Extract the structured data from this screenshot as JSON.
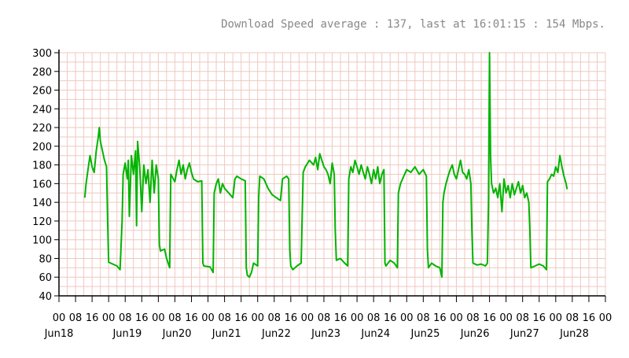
{
  "chart_data": {
    "type": "line",
    "title": "Download Speed average : 137, last at 16:01:15 : 154 Mbps.",
    "xlabel": "",
    "ylabel": "",
    "ylim": [
      40,
      300
    ],
    "yticks": [
      40,
      60,
      80,
      100,
      120,
      140,
      160,
      180,
      200,
      220,
      240,
      260,
      280,
      300
    ],
    "xlim": [
      0,
      264
    ],
    "x_unit": "hours since Jun18 00:00",
    "x_ticks": [
      {
        "hour": 0,
        "label": "00"
      },
      {
        "hour": 8,
        "label": "08"
      },
      {
        "hour": 16,
        "label": "16"
      },
      {
        "hour": 24,
        "label": "00"
      },
      {
        "hour": 32,
        "label": "08"
      },
      {
        "hour": 40,
        "label": "16"
      },
      {
        "hour": 48,
        "label": "00"
      },
      {
        "hour": 56,
        "label": "08"
      },
      {
        "hour": 64,
        "label": "16"
      },
      {
        "hour": 72,
        "label": "00"
      },
      {
        "hour": 80,
        "label": "08"
      },
      {
        "hour": 88,
        "label": "16"
      },
      {
        "hour": 96,
        "label": "00"
      },
      {
        "hour": 104,
        "label": "08"
      },
      {
        "hour": 112,
        "label": "16"
      },
      {
        "hour": 120,
        "label": "00"
      },
      {
        "hour": 128,
        "label": "08"
      },
      {
        "hour": 136,
        "label": "16"
      },
      {
        "hour": 144,
        "label": "00"
      },
      {
        "hour": 152,
        "label": "08"
      },
      {
        "hour": 160,
        "label": "16"
      },
      {
        "hour": 168,
        "label": "00"
      },
      {
        "hour": 176,
        "label": "08"
      },
      {
        "hour": 184,
        "label": "16"
      },
      {
        "hour": 192,
        "label": "00"
      },
      {
        "hour": 200,
        "label": "08"
      },
      {
        "hour": 208,
        "label": "16"
      },
      {
        "hour": 216,
        "label": "00"
      },
      {
        "hour": 224,
        "label": "08"
      },
      {
        "hour": 232,
        "label": "16"
      },
      {
        "hour": 240,
        "label": "00"
      },
      {
        "hour": 248,
        "label": "08"
      },
      {
        "hour": 256,
        "label": "16"
      },
      {
        "hour": 264,
        "label": "00"
      }
    ],
    "day_labels": [
      {
        "hour": 0,
        "label": "Jun18"
      },
      {
        "hour": 33,
        "label": "Jun19"
      },
      {
        "hour": 57,
        "label": "Jun20"
      },
      {
        "hour": 81,
        "label": "Jun21"
      },
      {
        "hour": 105,
        "label": "Jun22"
      },
      {
        "hour": 129,
        "label": "Jun23"
      },
      {
        "hour": 153,
        "label": "Jun24"
      },
      {
        "hour": 177,
        "label": "Jun25"
      },
      {
        "hour": 201,
        "label": "Jun26"
      },
      {
        "hour": 225,
        "label": "Jun27"
      },
      {
        "hour": 249,
        "label": "Jun28"
      }
    ],
    "grid": true,
    "colors": {
      "line": "#00b400",
      "grid": "#f0c8c0",
      "axis": "#000000",
      "text": "#000000",
      "title": "#888888"
    },
    "series": [
      {
        "name": "",
        "points": [
          [
            12.5,
            145
          ],
          [
            13,
            158
          ],
          [
            14,
            175
          ],
          [
            15,
            190
          ],
          [
            16,
            178
          ],
          [
            17,
            172
          ],
          [
            18,
            195
          ],
          [
            19,
            210
          ],
          [
            19.5,
            220
          ],
          [
            20,
            205
          ],
          [
            21,
            195
          ],
          [
            22,
            185
          ],
          [
            23,
            178
          ],
          [
            23.5,
            120
          ],
          [
            24,
            76
          ],
          [
            26,
            74
          ],
          [
            28,
            72
          ],
          [
            29.5,
            68
          ],
          [
            30.5,
            120
          ],
          [
            31,
            170
          ],
          [
            32,
            182
          ],
          [
            33,
            165
          ],
          [
            33.5,
            185
          ],
          [
            34,
            125
          ],
          [
            35,
            190
          ],
          [
            36,
            170
          ],
          [
            37,
            195
          ],
          [
            37.5,
            115
          ],
          [
            38,
            205
          ],
          [
            39,
            178
          ],
          [
            40,
            130
          ],
          [
            41,
            180
          ],
          [
            42,
            160
          ],
          [
            43,
            175
          ],
          [
            44,
            140
          ],
          [
            45,
            185
          ],
          [
            46,
            150
          ],
          [
            47,
            180
          ],
          [
            48,
            165
          ],
          [
            48.5,
            95
          ],
          [
            49,
            88
          ],
          [
            51,
            90
          ],
          [
            52,
            80
          ],
          [
            53.5,
            70
          ],
          [
            54,
            170
          ],
          [
            56,
            162
          ],
          [
            57,
            175
          ],
          [
            58,
            185
          ],
          [
            59,
            170
          ],
          [
            60,
            180
          ],
          [
            61,
            165
          ],
          [
            62,
            175
          ],
          [
            63,
            182
          ],
          [
            64,
            172
          ],
          [
            65,
            165
          ],
          [
            67,
            162
          ],
          [
            69,
            163
          ],
          [
            69.5,
            75
          ],
          [
            70,
            72
          ],
          [
            73,
            71
          ],
          [
            74.5,
            65
          ],
          [
            75,
            150
          ],
          [
            76,
            160
          ],
          [
            77,
            165
          ],
          [
            78,
            150
          ],
          [
            79,
            160
          ],
          [
            80,
            155
          ],
          [
            82,
            150
          ],
          [
            84,
            145
          ],
          [
            85,
            165
          ],
          [
            86,
            168
          ],
          [
            88,
            165
          ],
          [
            90,
            163
          ],
          [
            90.5,
            70
          ],
          [
            91,
            62
          ],
          [
            92,
            60
          ],
          [
            93,
            65
          ],
          [
            94,
            75
          ],
          [
            96,
            72
          ],
          [
            96.5,
            145
          ],
          [
            97,
            168
          ],
          [
            99,
            165
          ],
          [
            101,
            155
          ],
          [
            103,
            148
          ],
          [
            105,
            145
          ],
          [
            107,
            142
          ],
          [
            108,
            165
          ],
          [
            110,
            168
          ],
          [
            111,
            165
          ],
          [
            111.5,
            90
          ],
          [
            112,
            72
          ],
          [
            113,
            68
          ],
          [
            115,
            72
          ],
          [
            117,
            75
          ],
          [
            118,
            172
          ],
          [
            119,
            178
          ],
          [
            121,
            185
          ],
          [
            123,
            180
          ],
          [
            124,
            188
          ],
          [
            125,
            175
          ],
          [
            126,
            192
          ],
          [
            127,
            185
          ],
          [
            128,
            178
          ],
          [
            129,
            175
          ],
          [
            130,
            170
          ],
          [
            131,
            160
          ],
          [
            132,
            182
          ],
          [
            133,
            170
          ],
          [
            133.5,
            110
          ],
          [
            134,
            78
          ],
          [
            136,
            80
          ],
          [
            138,
            75
          ],
          [
            139.5,
            72
          ],
          [
            140,
            165
          ],
          [
            141,
            178
          ],
          [
            142,
            172
          ],
          [
            143,
            185
          ],
          [
            144,
            178
          ],
          [
            145,
            170
          ],
          [
            146,
            180
          ],
          [
            147,
            172
          ],
          [
            148,
            165
          ],
          [
            149,
            178
          ],
          [
            150,
            170
          ],
          [
            151,
            160
          ],
          [
            152,
            175
          ],
          [
            153,
            165
          ],
          [
            154,
            178
          ],
          [
            155,
            160
          ],
          [
            156,
            170
          ],
          [
            157,
            175
          ],
          [
            157.5,
            75
          ],
          [
            158,
            72
          ],
          [
            160,
            78
          ],
          [
            162,
            75
          ],
          [
            163.5,
            70
          ],
          [
            164,
            150
          ],
          [
            165,
            160
          ],
          [
            166,
            165
          ],
          [
            167,
            170
          ],
          [
            168,
            175
          ],
          [
            170,
            172
          ],
          [
            172,
            178
          ],
          [
            174,
            170
          ],
          [
            176,
            175
          ],
          [
            177.5,
            168
          ],
          [
            178,
            90
          ],
          [
            178.5,
            70
          ],
          [
            180,
            75
          ],
          [
            182,
            72
          ],
          [
            184,
            70
          ],
          [
            185,
            60
          ],
          [
            185.5,
            140
          ],
          [
            186,
            150
          ],
          [
            187,
            160
          ],
          [
            188,
            168
          ],
          [
            189,
            175
          ],
          [
            190,
            180
          ],
          [
            191,
            170
          ],
          [
            192,
            165
          ],
          [
            193,
            175
          ],
          [
            194,
            185
          ],
          [
            195,
            172
          ],
          [
            196,
            170
          ],
          [
            197,
            165
          ],
          [
            198,
            175
          ],
          [
            199,
            160
          ],
          [
            199.5,
            110
          ],
          [
            200,
            75
          ],
          [
            202,
            73
          ],
          [
            204,
            74
          ],
          [
            206,
            72
          ],
          [
            207,
            75
          ],
          [
            207.5,
            140
          ],
          [
            208,
            300
          ],
          [
            208.5,
            190
          ],
          [
            209,
            160
          ],
          [
            210,
            150
          ],
          [
            211,
            155
          ],
          [
            212,
            145
          ],
          [
            213,
            160
          ],
          [
            214,
            130
          ],
          [
            215,
            165
          ],
          [
            216,
            150
          ],
          [
            217,
            158
          ],
          [
            218,
            145
          ],
          [
            219,
            160
          ],
          [
            220,
            148
          ],
          [
            221,
            155
          ],
          [
            222,
            162
          ],
          [
            223,
            150
          ],
          [
            224,
            158
          ],
          [
            225,
            145
          ],
          [
            226,
            150
          ],
          [
            227,
            140
          ],
          [
            227.5,
            110
          ],
          [
            228,
            70
          ],
          [
            230,
            72
          ],
          [
            232,
            74
          ],
          [
            234,
            72
          ],
          [
            235.5,
            68
          ],
          [
            236,
            162
          ],
          [
            237,
            165
          ],
          [
            238,
            170
          ],
          [
            239,
            168
          ],
          [
            240,
            178
          ],
          [
            241,
            172
          ],
          [
            242,
            190
          ],
          [
            243,
            178
          ],
          [
            244,
            168
          ],
          [
            245,
            160
          ],
          [
            245.5,
            154
          ]
        ]
      }
    ]
  }
}
